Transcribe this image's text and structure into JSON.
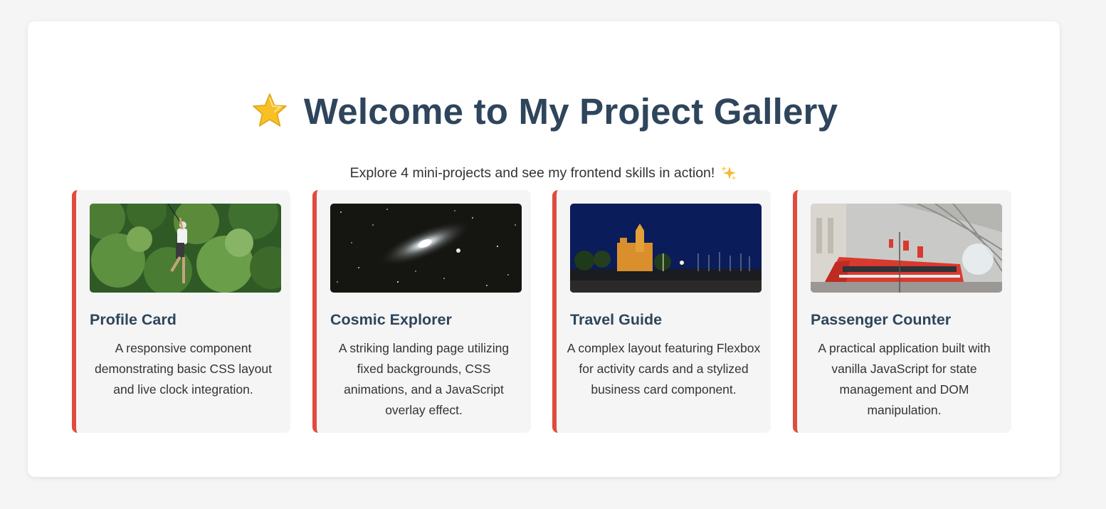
{
  "header": {
    "title": "Welcome to My Project Gallery",
    "title_icon": "star-icon",
    "subtitle": "Explore 4 mini-projects and see my frontend skills in action!",
    "subtitle_icon": "sparkle-icon"
  },
  "colors": {
    "title": "#2e455c",
    "accent": "#e14b3e",
    "card_bg": "#f4f5f4",
    "page_bg": "#f4f5f4"
  },
  "projects": [
    {
      "title": "Profile Card",
      "description": "A responsive component demonstrating basic CSS layout and live clock integration.",
      "image": "zipline-jungle-photo"
    },
    {
      "title": "Cosmic Explorer",
      "description": "A striking landing page utilizing fixed backgrounds, CSS animations, and a JavaScript overlay effect.",
      "image": "galaxy-photo"
    },
    {
      "title": "Travel Guide",
      "description": "A complex layout featuring Flexbox for activity cards and a stylized business card component.",
      "image": "night-waterfront-church-photo"
    },
    {
      "title": "Passenger Counter",
      "description": "A practical application built with vanilla JavaScript for state management and DOM manipulation.",
      "image": "train-station-photo"
    }
  ]
}
